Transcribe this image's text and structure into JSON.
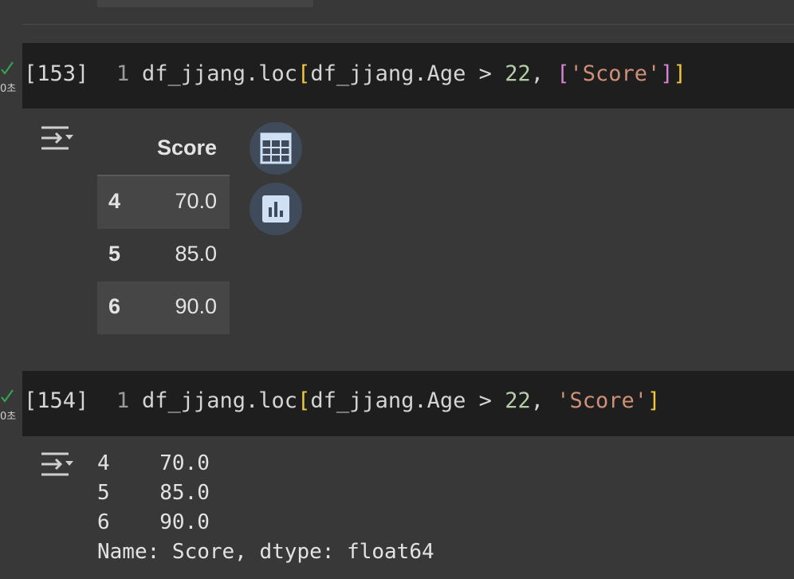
{
  "cell_153": {
    "exec_count": "[153]",
    "exec_time": "0초",
    "line_no": "1",
    "code_tokens": {
      "t1": "df_jjang.loc",
      "t2": "[",
      "t3": "df_jjang.Age > ",
      "t4": "22",
      "t5": ", ",
      "t6": "['Score']",
      "t7": "]"
    },
    "table": {
      "column": "Score",
      "rows": [
        {
          "index": "4",
          "value": "70.0"
        },
        {
          "index": "5",
          "value": "85.0"
        },
        {
          "index": "6",
          "value": "90.0"
        }
      ]
    }
  },
  "cell_154": {
    "exec_count": "[154]",
    "exec_time": "0초",
    "line_no": "1",
    "code_tokens": {
      "t1": "df_jjang.loc",
      "t2": "[",
      "t3": "df_jjang.Age > ",
      "t4": "22",
      "t5": ", ",
      "t6": "'Score'",
      "t7": "]"
    },
    "series_lines": [
      "4    70.0",
      "5    85.0",
      "6    90.0",
      "Name: Score, dtype: float64"
    ]
  },
  "colors": {
    "background": "#383838",
    "code_bg": "#1e1e1e",
    "bracket": "#f0c93b",
    "string": "#ce9178",
    "number": "#b5cea8",
    "list_bracket": "#d584d4",
    "check": "#34a853"
  },
  "icons": {
    "output_toggle": "output-toggle-icon",
    "table_action": "table-icon",
    "chart_action": "bar-chart-icon",
    "status": "check-icon"
  }
}
